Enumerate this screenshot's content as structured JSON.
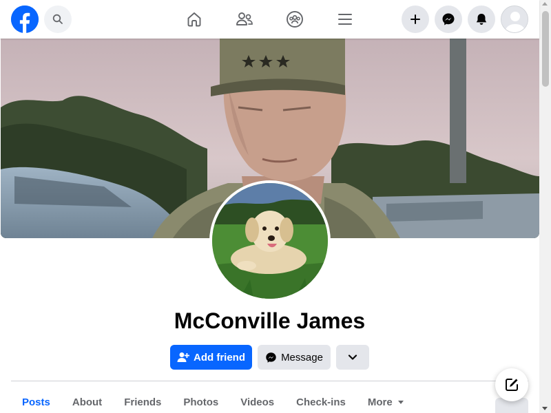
{
  "colors": {
    "brand": "#0866ff",
    "secondary_bg": "#e4e6eb",
    "text_secondary": "#65676b"
  },
  "topnav": {
    "logo_icon": "facebook-logo",
    "search_icon": "search-icon",
    "center_icons": [
      "home-icon",
      "friends-icon",
      "groups-icon",
      "menu-icon"
    ],
    "right_icons": [
      "plus-icon",
      "messenger-icon",
      "bell-icon",
      "avatar"
    ]
  },
  "profile": {
    "name": "McConville James",
    "actions": {
      "add_friend": "Add friend",
      "message": "Message"
    }
  },
  "tabs": [
    {
      "label": "Posts",
      "active": true
    },
    {
      "label": "About"
    },
    {
      "label": "Friends"
    },
    {
      "label": "Photos"
    },
    {
      "label": "Videos"
    },
    {
      "label": "Check-ins"
    },
    {
      "label": "More"
    }
  ]
}
